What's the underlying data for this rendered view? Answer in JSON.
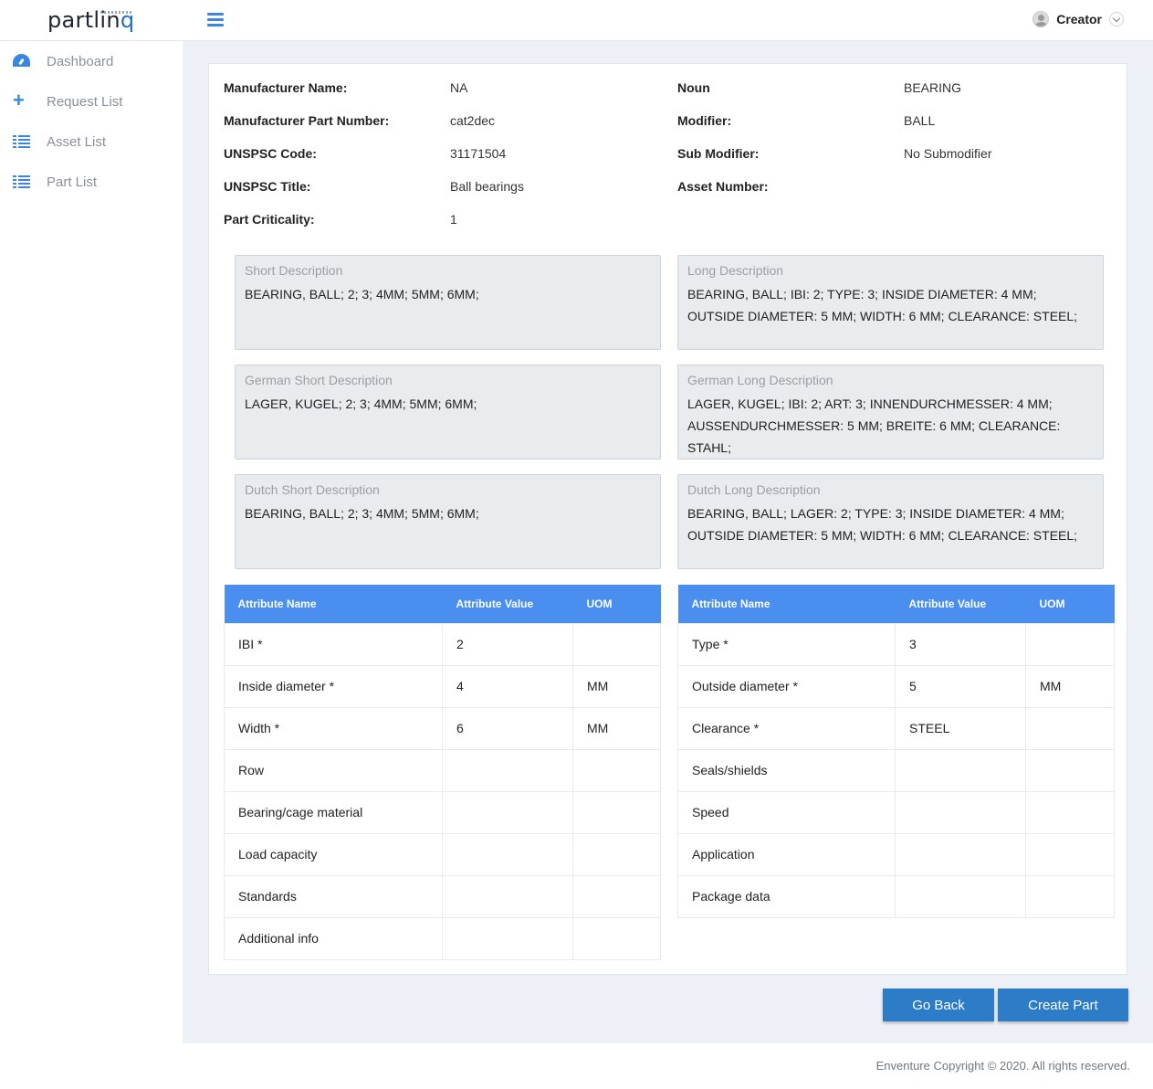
{
  "header": {
    "logo_main": "partlin",
    "logo_accent": "q",
    "user_name": "Creator"
  },
  "sidebar": {
    "items": [
      {
        "label": "Dashboard",
        "icon": "dashboard-icon"
      },
      {
        "label": "Request List",
        "icon": "plus-icon"
      },
      {
        "label": "Asset List",
        "icon": "list-icon"
      },
      {
        "label": "Part List",
        "icon": "list-icon"
      }
    ]
  },
  "details": {
    "manufacturer_name_label": "Manufacturer Name:",
    "manufacturer_name": "NA",
    "manufacturer_part_number_label": "Manufacturer Part Number:",
    "manufacturer_part_number": "cat2dec",
    "unspsc_code_label": "UNSPSC Code:",
    "unspsc_code": "31171504",
    "unspsc_title_label": "UNSPSC Title:",
    "unspsc_title": "Ball bearings",
    "part_criticality_label": "Part Criticality:",
    "part_criticality": "1",
    "noun_label": "Noun",
    "noun": "BEARING",
    "modifier_label": "Modifier:",
    "modifier": "BALL",
    "sub_modifier_label": "Sub Modifier:",
    "sub_modifier": "No Submodifier",
    "asset_number_label": "Asset Number:"
  },
  "descriptions": {
    "short": {
      "label": "Short Description",
      "text": "BEARING, BALL; 2; 3; 4MM; 5MM; 6MM;"
    },
    "long": {
      "label": "Long Description",
      "text": "BEARING, BALL; IBI: 2; TYPE: 3; INSIDE DIAMETER: 4 MM; OUTSIDE DIAMETER: 5 MM; WIDTH: 6 MM; CLEARANCE: STEEL;"
    },
    "german_short": {
      "label": "German Short Description",
      "text": "LAGER, KUGEL; 2; 3; 4MM; 5MM; 6MM;"
    },
    "german_long": {
      "label": "German Long Description",
      "text": "LAGER, KUGEL; IBI: 2; ART: 3; INNENDURCHMESSER: 4 MM; AUSSENDURCHMESSER: 5 MM; BREITE: 6 MM; CLEARANCE: STAHL;"
    },
    "dutch_short": {
      "label": "Dutch Short Description",
      "text": "BEARING, BALL; 2; 3; 4MM; 5MM; 6MM;"
    },
    "dutch_long": {
      "label": "Dutch Long Description",
      "text": "BEARING, BALL; LAGER: 2; TYPE: 3; INSIDE DIAMETER: 4 MM; OUTSIDE DIAMETER: 5 MM; WIDTH: 6 MM; CLEARANCE: STEEL;"
    }
  },
  "table_headers": {
    "name": "Attribute Name",
    "value": "Attribute Value",
    "uom": "UOM"
  },
  "left_table": [
    {
      "name": "IBI *",
      "value": "2",
      "uom": ""
    },
    {
      "name": "Inside diameter *",
      "value": "4",
      "uom": "MM"
    },
    {
      "name": "Width *",
      "value": "6",
      "uom": "MM"
    },
    {
      "name": "Row",
      "value": "",
      "uom": ""
    },
    {
      "name": "Bearing/cage material",
      "value": "",
      "uom": ""
    },
    {
      "name": "Load capacity",
      "value": "",
      "uom": ""
    },
    {
      "name": "Standards",
      "value": "",
      "uom": ""
    },
    {
      "name": "Additional info",
      "value": "",
      "uom": ""
    }
  ],
  "right_table": [
    {
      "name": "Type *",
      "value": "3",
      "uom": ""
    },
    {
      "name": "Outside diameter *",
      "value": "5",
      "uom": "MM"
    },
    {
      "name": "Clearance *",
      "value": "STEEL",
      "uom": ""
    },
    {
      "name": "Seals/shields",
      "value": "",
      "uom": ""
    },
    {
      "name": "Speed",
      "value": "",
      "uom": ""
    },
    {
      "name": "Application",
      "value": "",
      "uom": ""
    },
    {
      "name": "Package data",
      "value": "",
      "uom": ""
    }
  ],
  "buttons": {
    "go_back": "Go Back",
    "create_part": "Create Part"
  },
  "footer": {
    "copyright": "Enventure Copyright © 2020. All rights reserved."
  },
  "colors": {
    "accent": "#3a86e0",
    "table_header": "#4a8ff0",
    "button": "#2c7cc8",
    "content_bg": "#edf1f7"
  }
}
